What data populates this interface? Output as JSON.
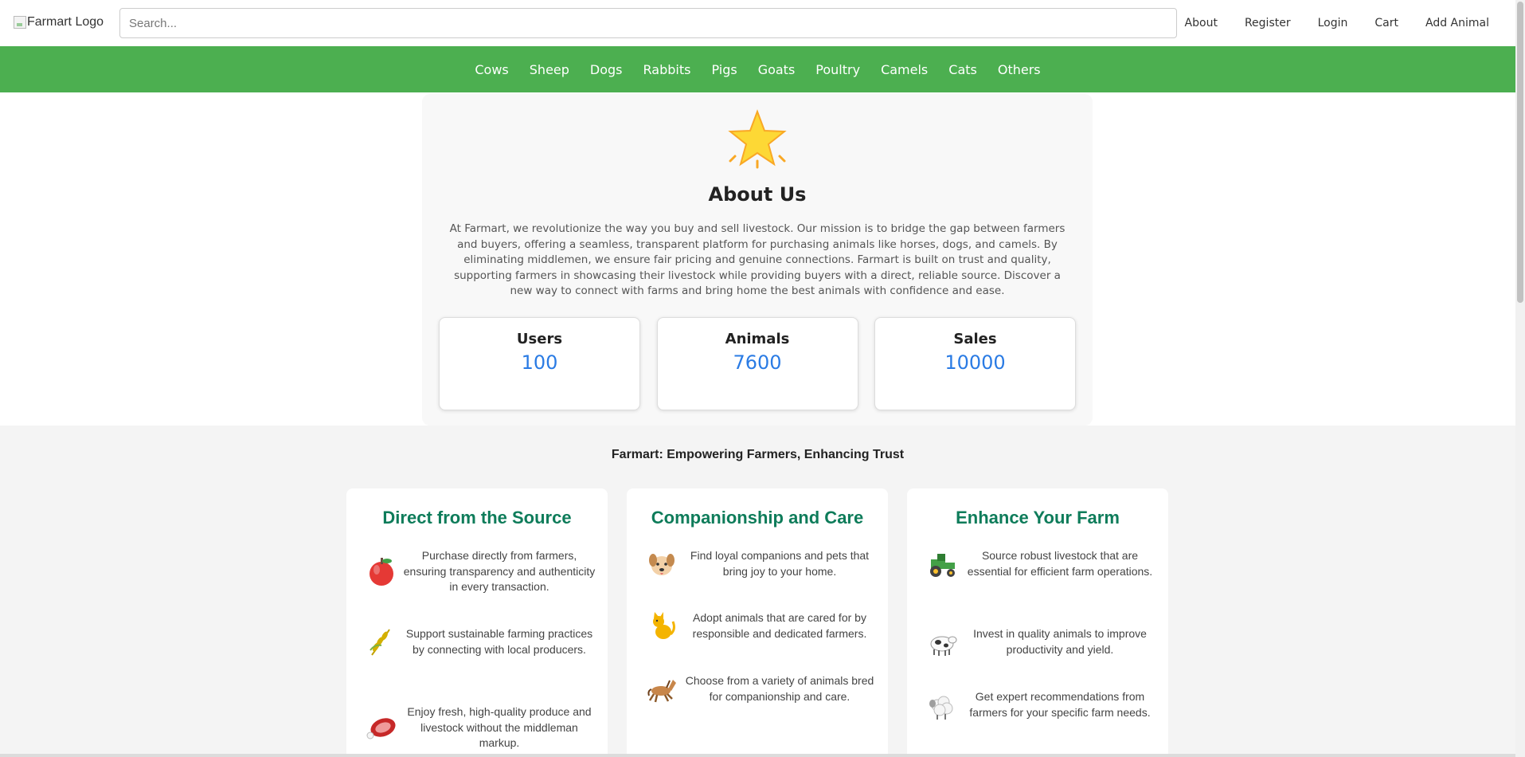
{
  "header": {
    "logo_alt": "Farmart Logo",
    "search_placeholder": "Search...",
    "nav": [
      "About",
      "Register",
      "Login",
      "Cart",
      "Add Animal"
    ]
  },
  "categories": [
    "Cows",
    "Sheep",
    "Dogs",
    "Rabbits",
    "Pigs",
    "Goats",
    "Poultry",
    "Camels",
    "Cats",
    "Others"
  ],
  "about": {
    "icon": "star-icon",
    "title": "About Us",
    "text": "At Farmart, we revolutionize the way you buy and sell livestock. Our mission is to bridge the gap between farmers and buyers, offering a seamless, transparent platform for purchasing animals like horses, dogs, and camels. By eliminating middlemen, we ensure fair pricing and genuine connections. Farmart is built on trust and quality, supporting farmers in showcasing their livestock while providing buyers with a direct, reliable source. Discover a new way to connect with farms and bring home the best animals with confidence and ease.",
    "stats": [
      {
        "label": "Users",
        "value": "100"
      },
      {
        "label": "Animals",
        "value": "7600"
      },
      {
        "label": "Sales",
        "value": "10000"
      }
    ]
  },
  "tagline": "Farmart: Empowering Farmers, Enhancing Trust",
  "features": [
    {
      "title": "Direct from the Source",
      "items": [
        {
          "icon": "apple-icon",
          "text": "Purchase directly from farmers, ensuring transparency and authenticity in every transaction."
        },
        {
          "icon": "wheat-icon",
          "text": "Support sustainable farming practices by connecting with local producers."
        },
        {
          "icon": "meat-icon",
          "text": "Enjoy fresh, high-quality produce and livestock without the middleman markup."
        }
      ]
    },
    {
      "title": "Companionship and Care",
      "items": [
        {
          "icon": "dog-icon",
          "text": "Find loyal companions and pets that bring joy to your home."
        },
        {
          "icon": "cat-icon",
          "text": "Adopt animals that are cared for by responsible and dedicated farmers."
        },
        {
          "icon": "horse-icon",
          "text": "Choose from a variety of animals bred for companionship and care."
        }
      ]
    },
    {
      "title": "Enhance Your Farm",
      "items": [
        {
          "icon": "tractor-icon",
          "text": "Source robust livestock that are essential for efficient farm operations."
        },
        {
          "icon": "cow-icon",
          "text": "Invest in quality animals to improve productivity and yield."
        },
        {
          "icon": "sheep-icon",
          "text": "Get expert recommendations from farmers for your specific farm needs."
        }
      ]
    }
  ],
  "colors": {
    "brand_green": "#4caf50",
    "stat_value_blue": "#2a7be4",
    "feature_title_green": "#0e7c5a"
  }
}
